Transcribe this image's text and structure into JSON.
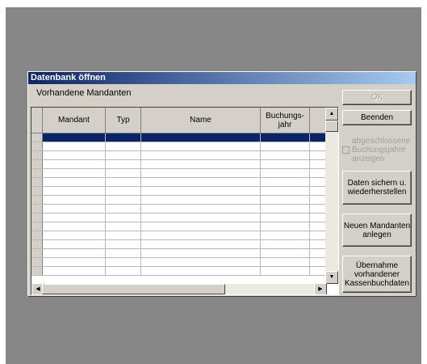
{
  "dialog": {
    "title": "Datenbank öffnen",
    "group_label": "Vorhandene Mandanten"
  },
  "table": {
    "columns": [
      "Mandant",
      "Typ",
      "Name",
      "Buchungs-\njahr",
      ""
    ],
    "rows": [
      {
        "selected": true
      },
      {},
      {},
      {},
      {},
      {},
      {},
      {},
      {},
      {},
      {},
      {},
      {},
      {},
      {},
      {}
    ]
  },
  "buttons": {
    "ok": "OK",
    "beenden": "Beenden",
    "sichern": "Daten sichern u.\nwiederherstellen",
    "neu": "Neuen Mandanten\nanlegen",
    "uebernahme": "Übernahme\nvorhandener\nKassenbuchdaten"
  },
  "checkbox": {
    "line1": "abgeschlossene",
    "line2": "Buchungsjahre",
    "line3": "anzeigen",
    "checked": false,
    "enabled": false
  },
  "colors": {
    "desktop": "#878787",
    "title_start": "#0a246a",
    "title_end": "#a6caf0",
    "selection": "#0a246a"
  }
}
